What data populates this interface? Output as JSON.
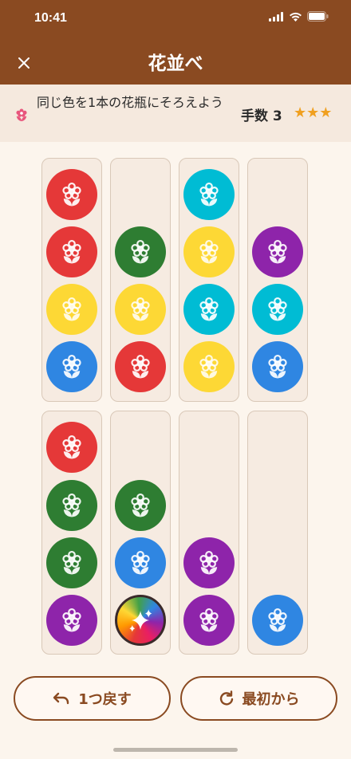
{
  "status": {
    "time": "10:41"
  },
  "header": {
    "title": "花並べ",
    "close_icon": "close-icon"
  },
  "info": {
    "icon": "flower-icon",
    "instruction": "同じ色を1本の花瓶にそろえよう",
    "moves": "手数 3",
    "stars": "★★★"
  },
  "colors": {
    "red": "#e53838",
    "green": "#2e7d32",
    "yellow": "#fdd835",
    "cyan": "#00bcd4",
    "blue": "#2f86e2",
    "purple": "#8e24aa",
    "brand": "#8a4a21"
  },
  "tubes": [
    [
      "blue",
      "yellow",
      "red",
      "red"
    ],
    [
      "red",
      "yellow",
      "green"
    ],
    [
      "yellow",
      "cyan",
      "yellow",
      "cyan"
    ],
    [
      "blue",
      "cyan",
      "purple"
    ],
    [
      "purple",
      "green",
      "green",
      "red"
    ],
    [
      "rainbow",
      "blue",
      "green"
    ],
    [
      "purple",
      "purple"
    ],
    [
      "blue"
    ]
  ],
  "buttons": {
    "undo": "1つ戻す",
    "restart": "最初から"
  }
}
